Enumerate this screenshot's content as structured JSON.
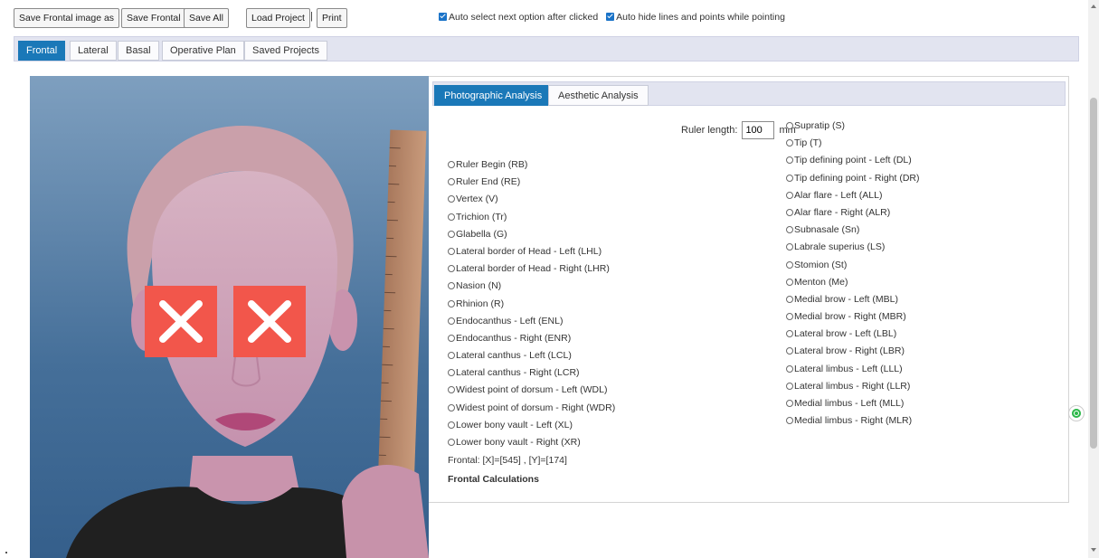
{
  "toolbar": {
    "save_frontal_image_as": "Save Frontal image as",
    "save_frontal": "Save Frontal",
    "save_all": "Save All",
    "load_project": "Load Project",
    "separator": "|",
    "print": "Print"
  },
  "options": {
    "auto_select": "Auto select next option after clicked",
    "auto_hide": "Auto hide lines and points while pointing"
  },
  "tabs": [
    "Frontal",
    "Lateral",
    "Basal",
    "Operative Plan",
    "Saved Projects"
  ],
  "active_tab": "Frontal",
  "analysis": {
    "subtabs": [
      "Photographic Analysis",
      "Aesthetic Analysis"
    ],
    "active_subtab": "Photographic Analysis",
    "ruler_label": "Ruler length:",
    "ruler_value": "100",
    "ruler_unit": "mm",
    "left_points": [
      "Ruler Begin (RB)",
      "Ruler End (RE)",
      "Vertex (V)",
      "Trichion (Tr)",
      "Glabella (G)",
      "Lateral border of Head - Left (LHL)",
      "Lateral border of Head - Right (LHR)",
      "Nasion (N)",
      "Rhinion (R)",
      "Endocanthus - Left (ENL)",
      "Endocanthus - Right (ENR)",
      "Lateral canthus - Left (LCL)",
      "Lateral canthus - Right (LCR)",
      "Widest point of dorsum - Left (WDL)",
      "Widest point of dorsum - Right (WDR)",
      "Lower bony vault - Left (XL)",
      "Lower bony vault - Right (XR)"
    ],
    "right_points": [
      "Supratip (S)",
      "Tip (T)",
      "Tip defining point - Left (DL)",
      "Tip defining point - Right (DR)",
      "Alar flare - Left (ALL)",
      "Alar flare - Right (ALR)",
      "Subnasale (Sn)",
      "Labrale superius (LS)",
      "Stomion (St)",
      "Menton (Me)",
      "Medial brow - Left (MBL)",
      "Medial brow - Right (MBR)",
      "Lateral brow - Left (LBL)",
      "Lateral brow - Right (LBR)",
      "Lateral limbus - Left (LLL)",
      "Lateral limbus - Right (LLR)",
      "Medial limbus - Left (MLL)",
      "Medial limbus - Right (MLR)"
    ],
    "coordinates": "Frontal: [X]=[545] , [Y]=[174]",
    "calculations_title": "Frontal Calculations"
  },
  "colors": {
    "accent": "#1a78b8",
    "tab_strip": "#e2e4f0",
    "photo_background": "#3f6d9b",
    "eye_mask": "#f2564b"
  },
  "icons": {
    "checkbox": "checkbox-checked-icon",
    "radio": "radio-unchecked-icon",
    "eye_mask": "close-x-icon",
    "floating": "green-dot-icon"
  }
}
